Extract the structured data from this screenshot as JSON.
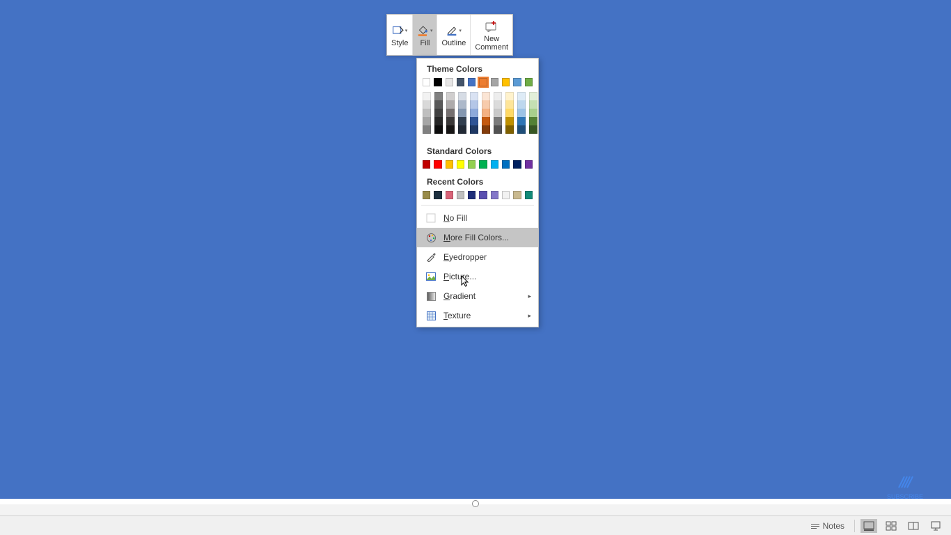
{
  "toolbar": {
    "style": "Style",
    "fill": "Fill",
    "outline": "Outline",
    "new_comment_l1": "New",
    "new_comment_l2": "Comment"
  },
  "dropdown": {
    "theme_title": "Theme Colors",
    "standard_title": "Standard Colors",
    "recent_title": "Recent Colors",
    "no_fill": "No Fill",
    "more_colors": "More Fill Colors...",
    "eyedropper": "Eyedropper",
    "picture": "Picture...",
    "gradient": "Gradient",
    "texture": "Texture",
    "theme_row": [
      "#ffffff",
      "#000000",
      "#e7e6e6",
      "#44546a",
      "#4472c4",
      "#ed7d31",
      "#a5a5a5",
      "#ffc000",
      "#5b9bd5",
      "#70ad47"
    ],
    "theme_shades": [
      [
        "#f2f2f2",
        "#d9d9d9",
        "#bfbfbf",
        "#a6a6a6",
        "#808080"
      ],
      [
        "#808080",
        "#595959",
        "#404040",
        "#262626",
        "#0d0d0d"
      ],
      [
        "#d0cece",
        "#aeabab",
        "#757070",
        "#3a3838",
        "#171616"
      ],
      [
        "#d6dce5",
        "#adb9ca",
        "#8497b0",
        "#323f4f",
        "#222a35"
      ],
      [
        "#d9e2f3",
        "#b4c6e7",
        "#8eaadb",
        "#2f5496",
        "#1f3864"
      ],
      [
        "#fbe5d5",
        "#f7cbac",
        "#f4b183",
        "#c55a11",
        "#833c0b"
      ],
      [
        "#ededed",
        "#dbdbdb",
        "#c9c9c9",
        "#7b7b7b",
        "#525252"
      ],
      [
        "#fff2cc",
        "#fee599",
        "#ffd965",
        "#bf9000",
        "#7f6000"
      ],
      [
        "#deebf6",
        "#bdd7ee",
        "#9cc3e6",
        "#2e75b5",
        "#1f4e79"
      ],
      [
        "#e2efd9",
        "#c5e0b3",
        "#a8d08d",
        "#538135",
        "#375623"
      ]
    ],
    "standard_row": [
      "#c00000",
      "#ff0000",
      "#ffc000",
      "#ffff00",
      "#92d050",
      "#00b050",
      "#00b0f0",
      "#0070c0",
      "#002060",
      "#7030a0"
    ],
    "recent_row": [
      "#998c4a",
      "#1c2f3e",
      "#d96378",
      "#bfbfbf",
      "#1f2e7a",
      "#5a4fb0",
      "#8477c9",
      "#f2f2f2",
      "#c9b98f",
      "#128a78"
    ]
  },
  "statusbar": {
    "notes": "Notes"
  },
  "watermark": {
    "text": "SUBSCRIBE"
  },
  "selected_theme_index": 5
}
